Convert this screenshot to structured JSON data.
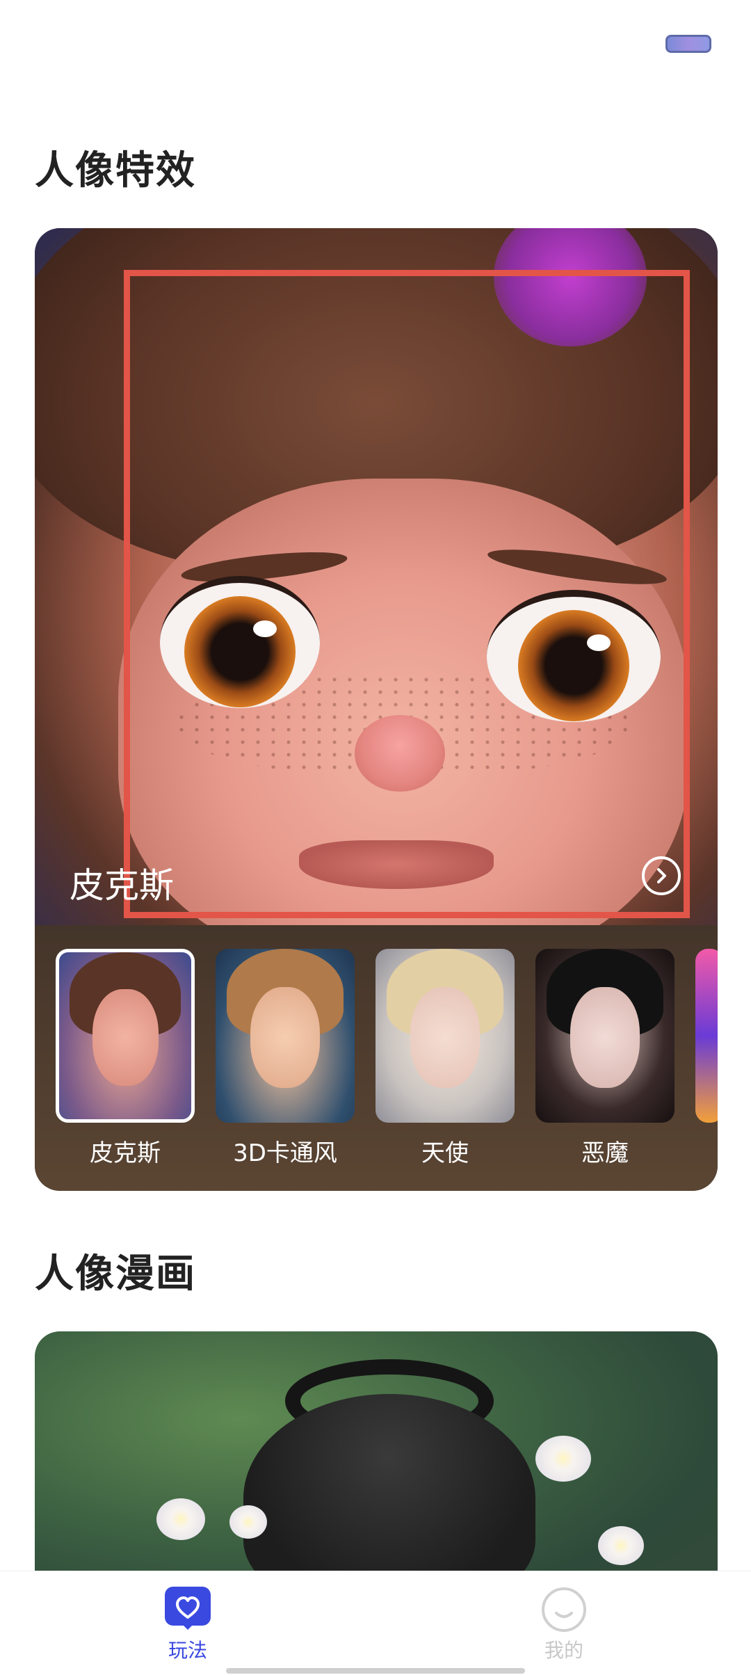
{
  "sections": {
    "effects_title": "人像特效",
    "comics_title": "人像漫画"
  },
  "hero": {
    "label": "皮克斯"
  },
  "styles": [
    {
      "label": "皮克斯",
      "selected": true
    },
    {
      "label": "3D卡通风",
      "selected": false
    },
    {
      "label": "天使",
      "selected": false
    },
    {
      "label": "恶魔",
      "selected": false
    }
  ],
  "nav": {
    "play_label": "玩法",
    "mine_label": "我的"
  },
  "colors": {
    "accent": "#3a49e0",
    "selection_box": "#e25548",
    "inactive": "#c8c8c8"
  },
  "icons": {
    "hero_arrow": "chevron-right-circle-icon",
    "nav_play": "heart-icon",
    "nav_mine": "smiley-face-icon"
  }
}
